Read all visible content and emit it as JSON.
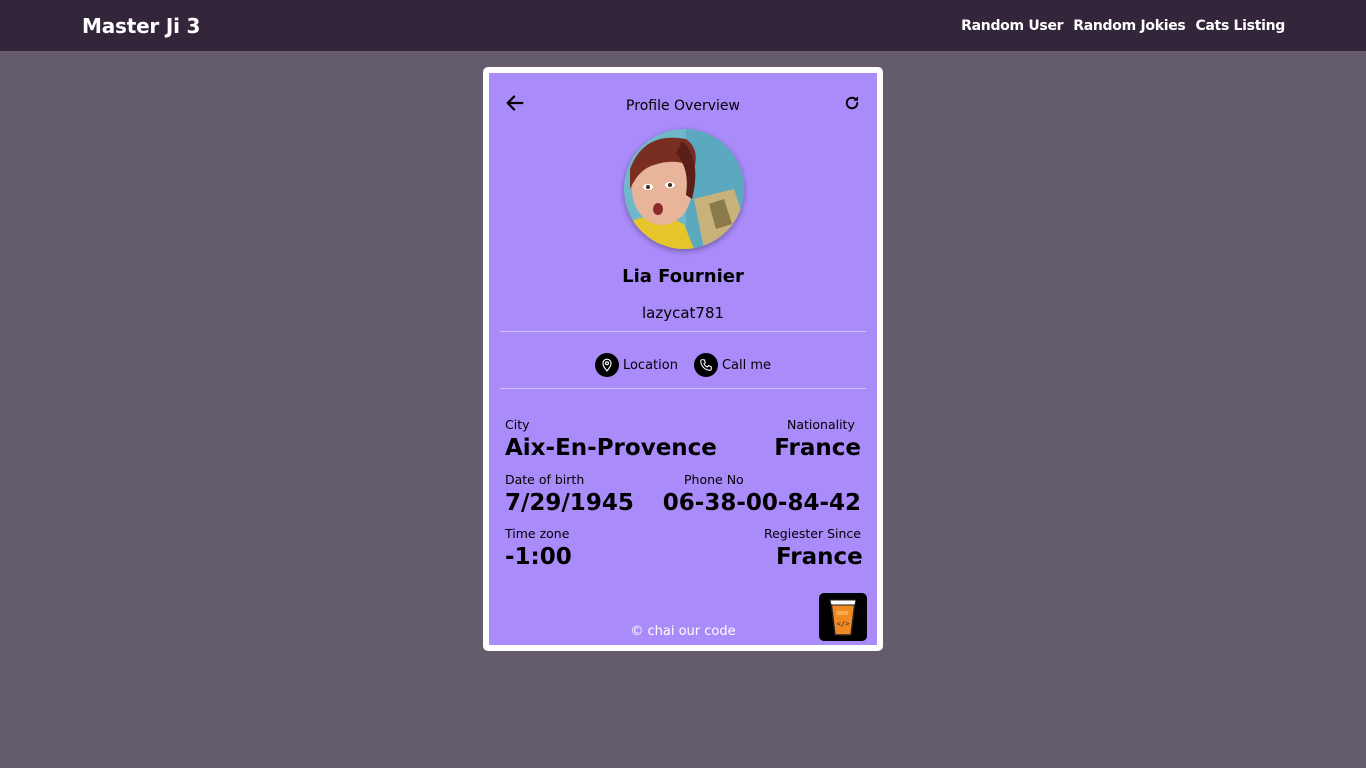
{
  "navbar": {
    "brand": "Master Ji 3",
    "links": [
      "Random User",
      "Random Jokies",
      "Cats Listing"
    ]
  },
  "card": {
    "title": "Profile Overview",
    "name": "Lia Fournier",
    "username": "lazycat781",
    "actions": {
      "location": "Location",
      "call": "Call me"
    },
    "city": {
      "label": "City",
      "value": "Aix-En-Provence"
    },
    "nationality": {
      "label": "Nationality",
      "value": "France"
    },
    "dob": {
      "label": "Date of birth",
      "value": "7/29/1945"
    },
    "phone": {
      "label": "Phone No",
      "value": "06-38-00-84-42"
    },
    "timezone": {
      "label": "Time zone",
      "value": "-1:00"
    },
    "registered": {
      "label": "Regiester Since",
      "value": "France"
    },
    "footer": "© chai our code"
  },
  "colors": {
    "navbar_bg": "#33263a",
    "page_bg": "#645c6c",
    "card_bg": "#a98bfa",
    "card_border": "#ffffff"
  },
  "icons": [
    "arrow-left-icon",
    "refresh-icon",
    "map-pin-icon",
    "phone-icon",
    "chai-cup-icon"
  ]
}
